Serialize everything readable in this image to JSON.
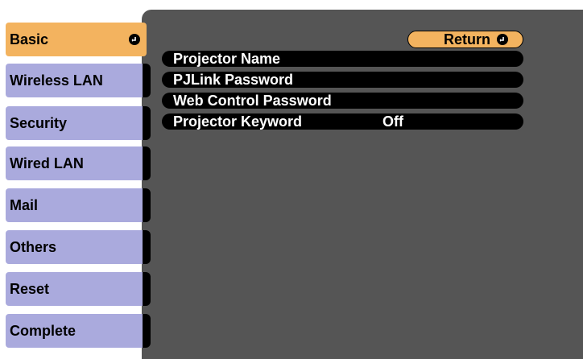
{
  "sidebar": {
    "items": [
      {
        "label": "Basic",
        "active": true
      },
      {
        "label": "Wireless LAN"
      },
      {
        "label": "Security"
      },
      {
        "label": "Wired LAN"
      },
      {
        "label": "Mail"
      },
      {
        "label": "Others"
      },
      {
        "label": "Reset"
      },
      {
        "label": "Complete"
      }
    ]
  },
  "main": {
    "return_label": "Return",
    "rows": [
      {
        "label": "Projector Name",
        "value": ""
      },
      {
        "label": "PJLink Password",
        "value": ""
      },
      {
        "label": "Web Control Password",
        "value": ""
      },
      {
        "label": "Projector Keyword",
        "value": "Off"
      }
    ]
  },
  "colors": {
    "accent": "#f3b35f",
    "tab": "#aaaadd",
    "panel": "#555555"
  },
  "icons": {
    "enter": "enter-icon"
  }
}
